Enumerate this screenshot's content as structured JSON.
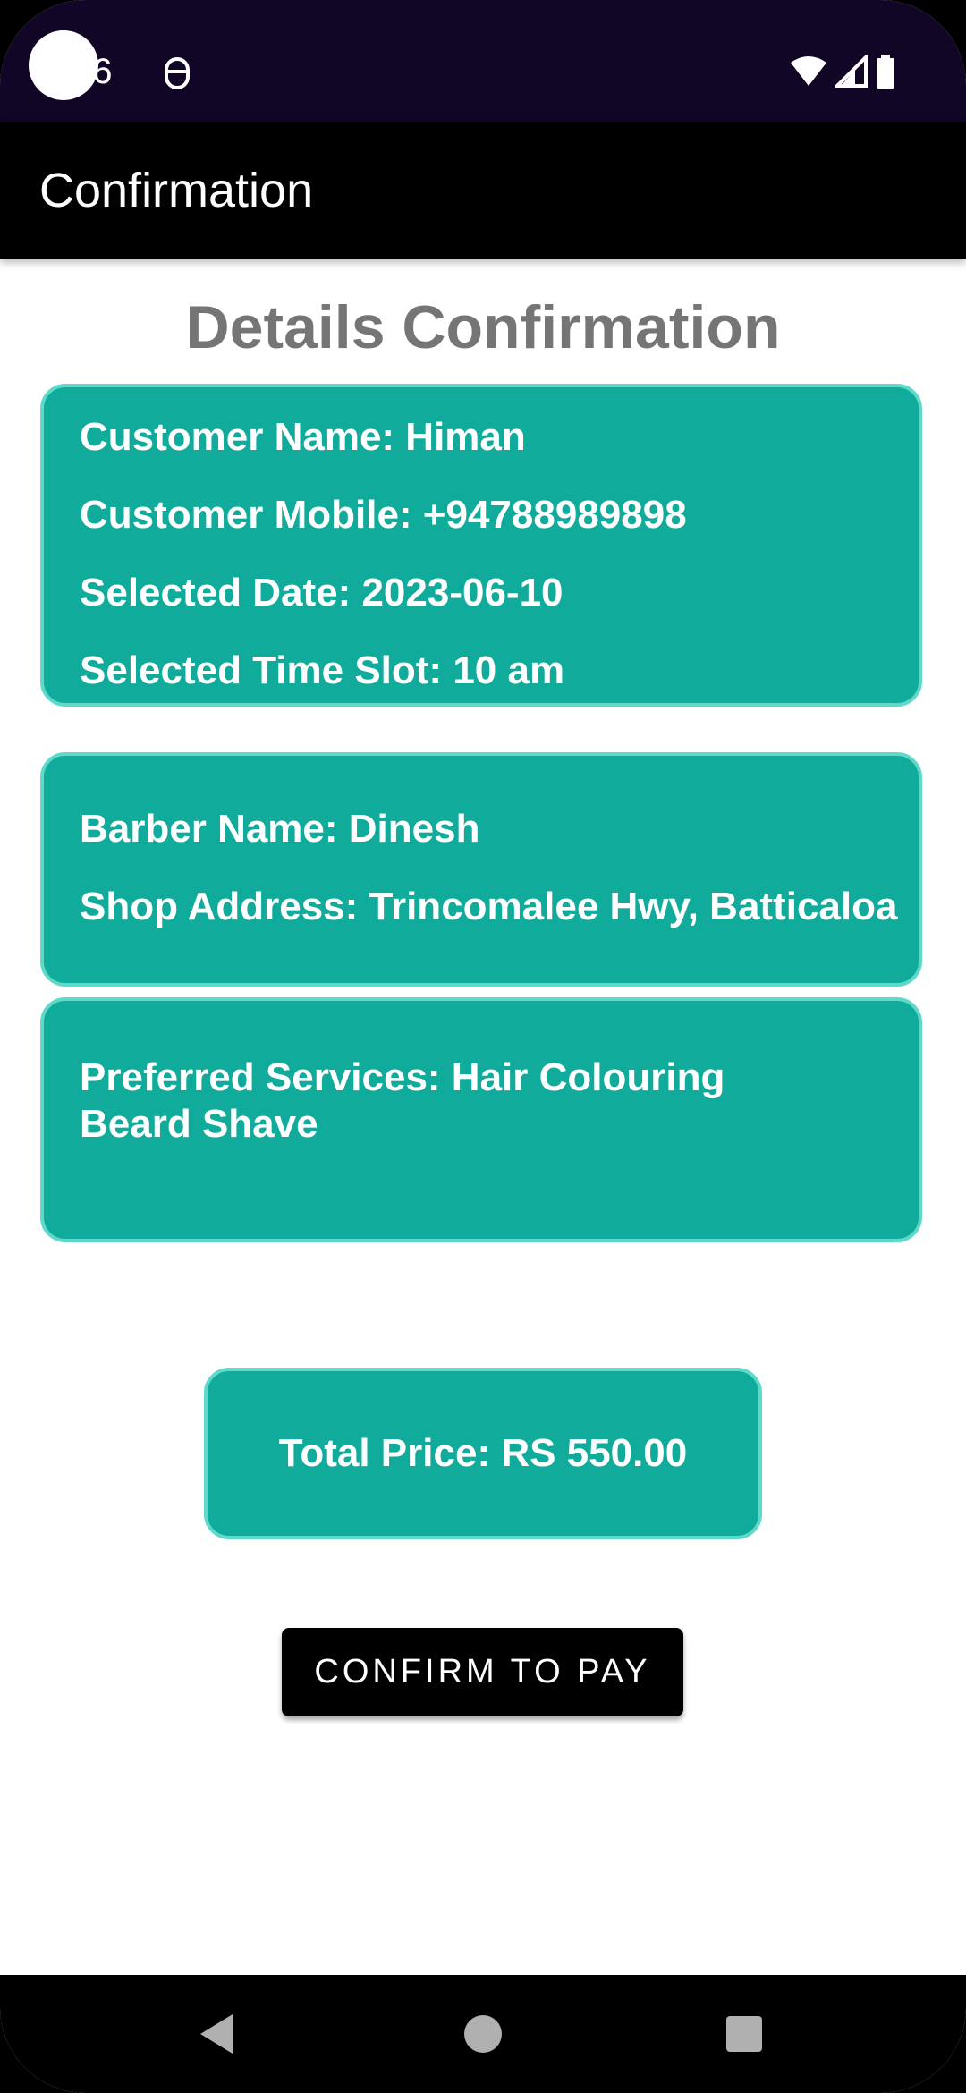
{
  "status_bar": {
    "time": "16",
    "icons": [
      "notification-icon",
      "wifi-icon",
      "signal-icon",
      "battery-icon"
    ]
  },
  "app_bar": {
    "title": "Confirmation"
  },
  "page": {
    "heading": "Details Confirmation"
  },
  "customer_card": {
    "name": "Customer Name: Himan",
    "mobile": "Customer Mobile: +94788989898",
    "date": "Selected Date: 2023-06-10",
    "time_slot": "Selected Time Slot: 10 am"
  },
  "barber_card": {
    "barber_name": "Barber Name: Dinesh",
    "shop_address": "Shop Address: Trincomalee Hwy, Batticaloa"
  },
  "services_card": {
    "services": "Preferred Services: Hair Colouring\nBeard Shave"
  },
  "price_card": {
    "total": "Total Price: RS 550.00"
  },
  "actions": {
    "confirm_label": "CONFIRM TO PAY"
  },
  "nav_bar": {
    "icons": [
      "back-icon",
      "home-icon",
      "recents-icon"
    ]
  },
  "colors": {
    "status_bar_bg": "#120626",
    "app_bar_bg": "#000000",
    "card_bg": "#10ab9b",
    "card_border": "#5fd9ca",
    "heading_text": "#757575",
    "button_bg": "#000000"
  }
}
